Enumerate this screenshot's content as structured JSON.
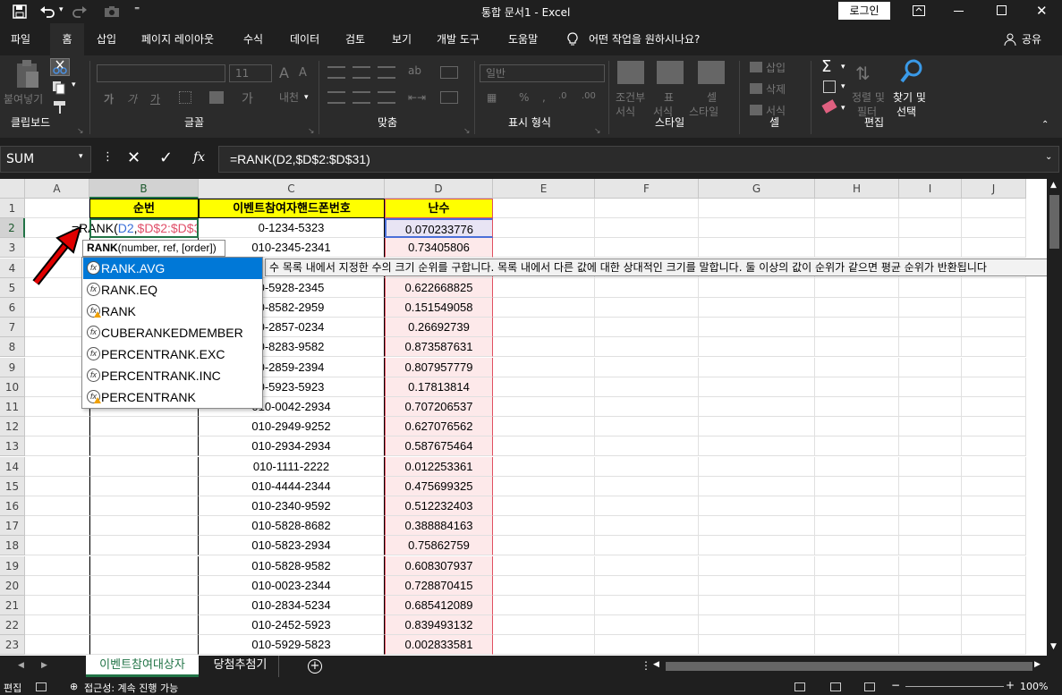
{
  "titlebar": {
    "title": "통합 문서1 - Excel",
    "login": "로그인"
  },
  "ribbon_tabs": [
    "파일",
    "홈",
    "삽입",
    "페이지 레이아웃",
    "수식",
    "데이터",
    "검토",
    "보기",
    "개발 도구",
    "도움말"
  ],
  "ribbon_active": "홈",
  "tell_me": "어떤 작업을 원하시나요?",
  "share": "공유",
  "ribbon": {
    "paste": "붙여넣기",
    "font_size": "11",
    "number_format": "일반",
    "cond_format": [
      "조건부",
      "서식"
    ],
    "table_format": [
      "표",
      "서식"
    ],
    "cell_style": [
      "셀",
      "스타일"
    ],
    "insert": "삽입",
    "delete": "삭제",
    "format": "서식",
    "sort_filter": [
      "정렬 및",
      "필터"
    ],
    "find_select": [
      "찾기 및",
      "선택"
    ],
    "groups": {
      "clipboard": "클립보드",
      "font": "글꼴",
      "align": "맞춤",
      "number": "표시 형식",
      "styles": "스타일",
      "cells": "셀",
      "editing": "편집"
    }
  },
  "formula_bar": {
    "name_box": "SUM",
    "formula": "=RANK(D2,$D$2:$D$31)"
  },
  "columns": [
    "A",
    "B",
    "C",
    "D",
    "E",
    "F",
    "G",
    "H",
    "I",
    "J"
  ],
  "rows": [
    "1",
    "2",
    "3",
    "4",
    "5",
    "6",
    "7",
    "8",
    "9",
    "10",
    "11",
    "12",
    "13",
    "14",
    "15",
    "16",
    "17",
    "18",
    "19",
    "20",
    "21",
    "22",
    "23"
  ],
  "headers": {
    "b": "순번",
    "c": "이벤트참여자핸드폰번호",
    "d": "난수"
  },
  "edit_cell": {
    "prefix": "=RANK(",
    "arg1": "D2",
    "comma": ",",
    "arg2": "$D$2:$D$31",
    "suffix": ")"
  },
  "c_values": [
    "0-1234-5323",
    "010-2345-2341",
    "",
    "0-5928-2345",
    "0-8582-2959",
    "0-2857-0234",
    "0-8283-9582",
    "0-2859-2394",
    "0-5923-5923",
    "010-0042-2934",
    "010-2949-9252",
    "010-2934-2934",
    "010-1111-2222",
    "010-4444-2344",
    "010-2340-9592",
    "010-5828-8682",
    "010-5823-2934",
    "010-5828-9582",
    "010-0023-2344",
    "010-2834-5234",
    "010-2452-5923",
    "010-5929-5823"
  ],
  "d_values": [
    "0.070233776",
    "0.73405806",
    "",
    "0.622668825",
    "0.151549058",
    "0.26692739",
    "0.873587631",
    "0.807957779",
    "0.17813814",
    "0.707206537",
    "0.627076562",
    "0.587675464",
    "0.012253361",
    "0.475699325",
    "0.512232403",
    "0.388884163",
    "0.75862759",
    "0.608307937",
    "0.728870415",
    "0.685412089",
    "0.839493132",
    "0.002833581"
  ],
  "tooltip": {
    "fn": "RANK",
    "args": "(number, ref, [order])"
  },
  "description": "수 목록 내에서 지정한 수의 크기 순위를 구합니다. 목록 내에서 다른 값에 대한 상대적인 크기를 말합니다. 둘 이상의 값이 순위가 같으면 평균 순위가 반환됩니다",
  "autocomplete": [
    {
      "label": "RANK.AVG",
      "warn": false
    },
    {
      "label": "RANK.EQ",
      "warn": false
    },
    {
      "label": "RANK",
      "warn": true
    },
    {
      "label": "CUBERANKEDMEMBER",
      "warn": false
    },
    {
      "label": "PERCENTRANK.EXC",
      "warn": false
    },
    {
      "label": "PERCENTRANK.INC",
      "warn": false
    },
    {
      "label": "PERCENTRANK",
      "warn": true
    }
  ],
  "sheet_tabs": [
    "이벤트참여대상자",
    "당첨추첨기"
  ],
  "status": {
    "mode": "편집",
    "accessibility": "접근성: 계속 진행 가능",
    "zoom": "100%"
  }
}
